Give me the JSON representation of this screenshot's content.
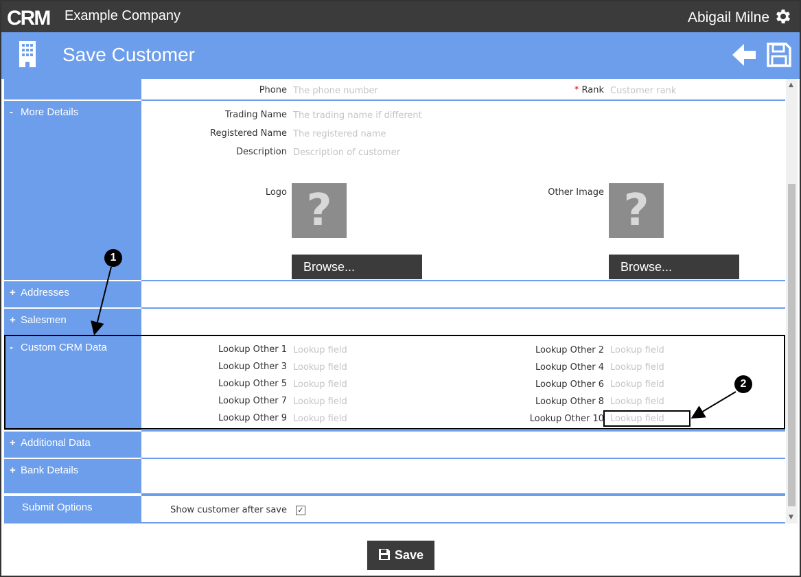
{
  "header": {
    "logo_text": "CRM",
    "company": "Example Company",
    "user": "Abigail Milne"
  },
  "title": "Save Customer",
  "top_fields": {
    "phone_label": "Phone",
    "phone_placeholder": "The phone number",
    "rank_required": "*",
    "rank_label": "Rank",
    "rank_placeholder": "Customer rank"
  },
  "sections": {
    "more_details": {
      "symbol": "-",
      "label": "More Details"
    },
    "addresses": {
      "symbol": "+",
      "label": "Addresses"
    },
    "salesmen": {
      "symbol": "+",
      "label": "Salesmen"
    },
    "custom_crm": {
      "symbol": "-",
      "label": "Custom CRM Data"
    },
    "additional": {
      "symbol": "+",
      "label": "Additional Data"
    },
    "bank": {
      "symbol": "+",
      "label": "Bank Details"
    },
    "submit": {
      "label": "Submit Options"
    }
  },
  "more_details": {
    "trading_label": "Trading Name",
    "trading_placeholder": "The trading name if different",
    "registered_label": "Registered Name",
    "registered_placeholder": "The registered name",
    "description_label": "Description",
    "description_placeholder": "Description of customer",
    "logo_label": "Logo",
    "other_image_label": "Other Image",
    "image_placeholder": "?",
    "browse": "Browse..."
  },
  "custom_crm": {
    "placeholder": "Lookup field",
    "left": [
      "Lookup Other 1",
      "Lookup Other 3",
      "Lookup Other 5",
      "Lookup Other 7",
      "Lookup Other 9"
    ],
    "right": [
      "Lookup Other 2",
      "Lookup Other 4",
      "Lookup Other 6",
      "Lookup Other 8",
      "Lookup Other 10"
    ]
  },
  "submit_options": {
    "show_after_save_label": "Show customer after save",
    "show_after_save_checked": true,
    "check_glyph": "✓"
  },
  "save_button": "Save",
  "callouts": [
    "1",
    "2"
  ],
  "colors": {
    "accent": "#6d9eeb",
    "dark": "#3b3b3b"
  }
}
